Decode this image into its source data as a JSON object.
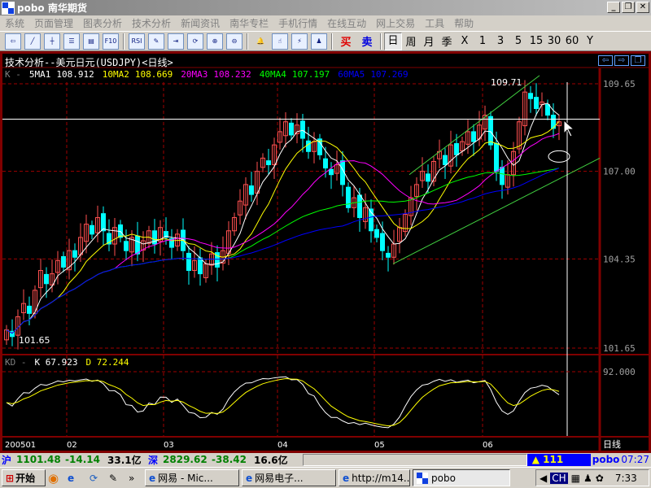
{
  "window": {
    "title": "pobo 南华期货",
    "min": "_",
    "restore": "❐",
    "close": "✕"
  },
  "menu": [
    "系统",
    "页面管理",
    "图表分析",
    "技术分析",
    "新闻资讯",
    "南华专栏",
    "手机行情",
    "在线互动",
    "网上交易",
    "工具",
    "帮助"
  ],
  "toolbar": {
    "icons": [
      "back-icon",
      "line-chart-icon",
      "candle-icon",
      "list-icon",
      "news-icon",
      "f10-icon",
      "rsi-icon",
      "draw-icon",
      "import-icon",
      "refresh-icon",
      "zoom-in-icon",
      "zoom-out-icon",
      "alarm-icon",
      "hand-icon",
      "plug-icon",
      "users-icon"
    ],
    "rsi": "RSI",
    "f10": "F10",
    "buy": "买",
    "sell": "卖",
    "periods": [
      "日",
      "周",
      "月",
      "季",
      "X",
      "1",
      "3",
      "5",
      "15",
      "30",
      "60",
      "Y"
    ],
    "active_period": "日"
  },
  "chart": {
    "title": "技术分析--美元日元(USDJPY)<日线>",
    "ma_prefix": "K -",
    "ma": [
      {
        "label": "5MA1",
        "value": "108.912",
        "color": "#ffffff"
      },
      {
        "label": "10MA2",
        "value": "108.669",
        "color": "#ffff00"
      },
      {
        "label": "20MA3",
        "value": "108.232",
        "color": "#ff00ff"
      },
      {
        "label": "40MA4",
        "value": "107.197",
        "color": "#00ff00"
      },
      {
        "label": "60MA5",
        "value": "107.269",
        "color": "#0000ff"
      }
    ],
    "high_label": "109.71",
    "low_label": "101.65",
    "y_ticks": [
      "109.65",
      "107.00",
      "104.35",
      "101.65"
    ],
    "kd_label": "KD -",
    "kd_k": "K 67.923",
    "kd_d": "D 72.244",
    "kd_tick": "92.000",
    "x_labels": [
      "200501",
      "02",
      "03",
      "04",
      "05",
      "06"
    ],
    "period_label": "日线"
  },
  "chart_data": {
    "type": "candlestick",
    "ylim": [
      101.65,
      109.65
    ],
    "y_ticks": [
      109.65,
      107.0,
      104.35,
      101.65
    ],
    "close": [
      102.2,
      102.0,
      102.6,
      103.0,
      102.7,
      103.4,
      104.0,
      103.6,
      103.9,
      104.3,
      104.1,
      104.6,
      104.4,
      105.0,
      105.4,
      105.1,
      105.6,
      105.2,
      104.8,
      105.3,
      105.0,
      104.6,
      105.0,
      104.5,
      104.9,
      105.2,
      104.8,
      105.3,
      105.0,
      104.7,
      105.1,
      104.6,
      104.0,
      104.3,
      103.9,
      104.2,
      104.5,
      104.1,
      104.6,
      105.2,
      105.6,
      106.1,
      106.6,
      106.3,
      107.0,
      107.4,
      107.2,
      107.8,
      108.2,
      108.5,
      108.1,
      108.4,
      108.0,
      107.6,
      107.9,
      107.5,
      107.1,
      106.9,
      107.2,
      106.6,
      105.9,
      106.2,
      105.6,
      105.9,
      105.2,
      105.0,
      104.6,
      104.4,
      104.8,
      105.3,
      105.7,
      106.2,
      106.6,
      107.0,
      106.7,
      107.3,
      107.6,
      107.2,
      107.8,
      107.5,
      107.9,
      108.2,
      107.9,
      108.4,
      108.7,
      107.8,
      107.0,
      106.6,
      106.9,
      107.6,
      108.5,
      109.4,
      109.2,
      108.9,
      109.1,
      108.7,
      108.3,
      108.5
    ],
    "month_starts": [
      0,
      11,
      28,
      48,
      65,
      84
    ],
    "ma_periods": [
      5,
      10,
      20,
      40,
      60
    ]
  },
  "status": {
    "sh_label": "沪",
    "sh_index": "1101.48",
    "sh_change": "-14.14",
    "sh_volume": "33.1亿",
    "sz_label": "深",
    "sz_index": "2829.62",
    "sz_change": "-38.42",
    "sz_volume": "16.6亿",
    "alert": "▲ 111",
    "brand": "pobo",
    "time": "07:27"
  },
  "taskbar": {
    "start": "开始",
    "more": "»",
    "tasks": [
      "网易 - Mic...",
      "网易电子...",
      "http://m14...",
      "pobo"
    ],
    "tray_lang": "CH",
    "clock": "7:33"
  }
}
